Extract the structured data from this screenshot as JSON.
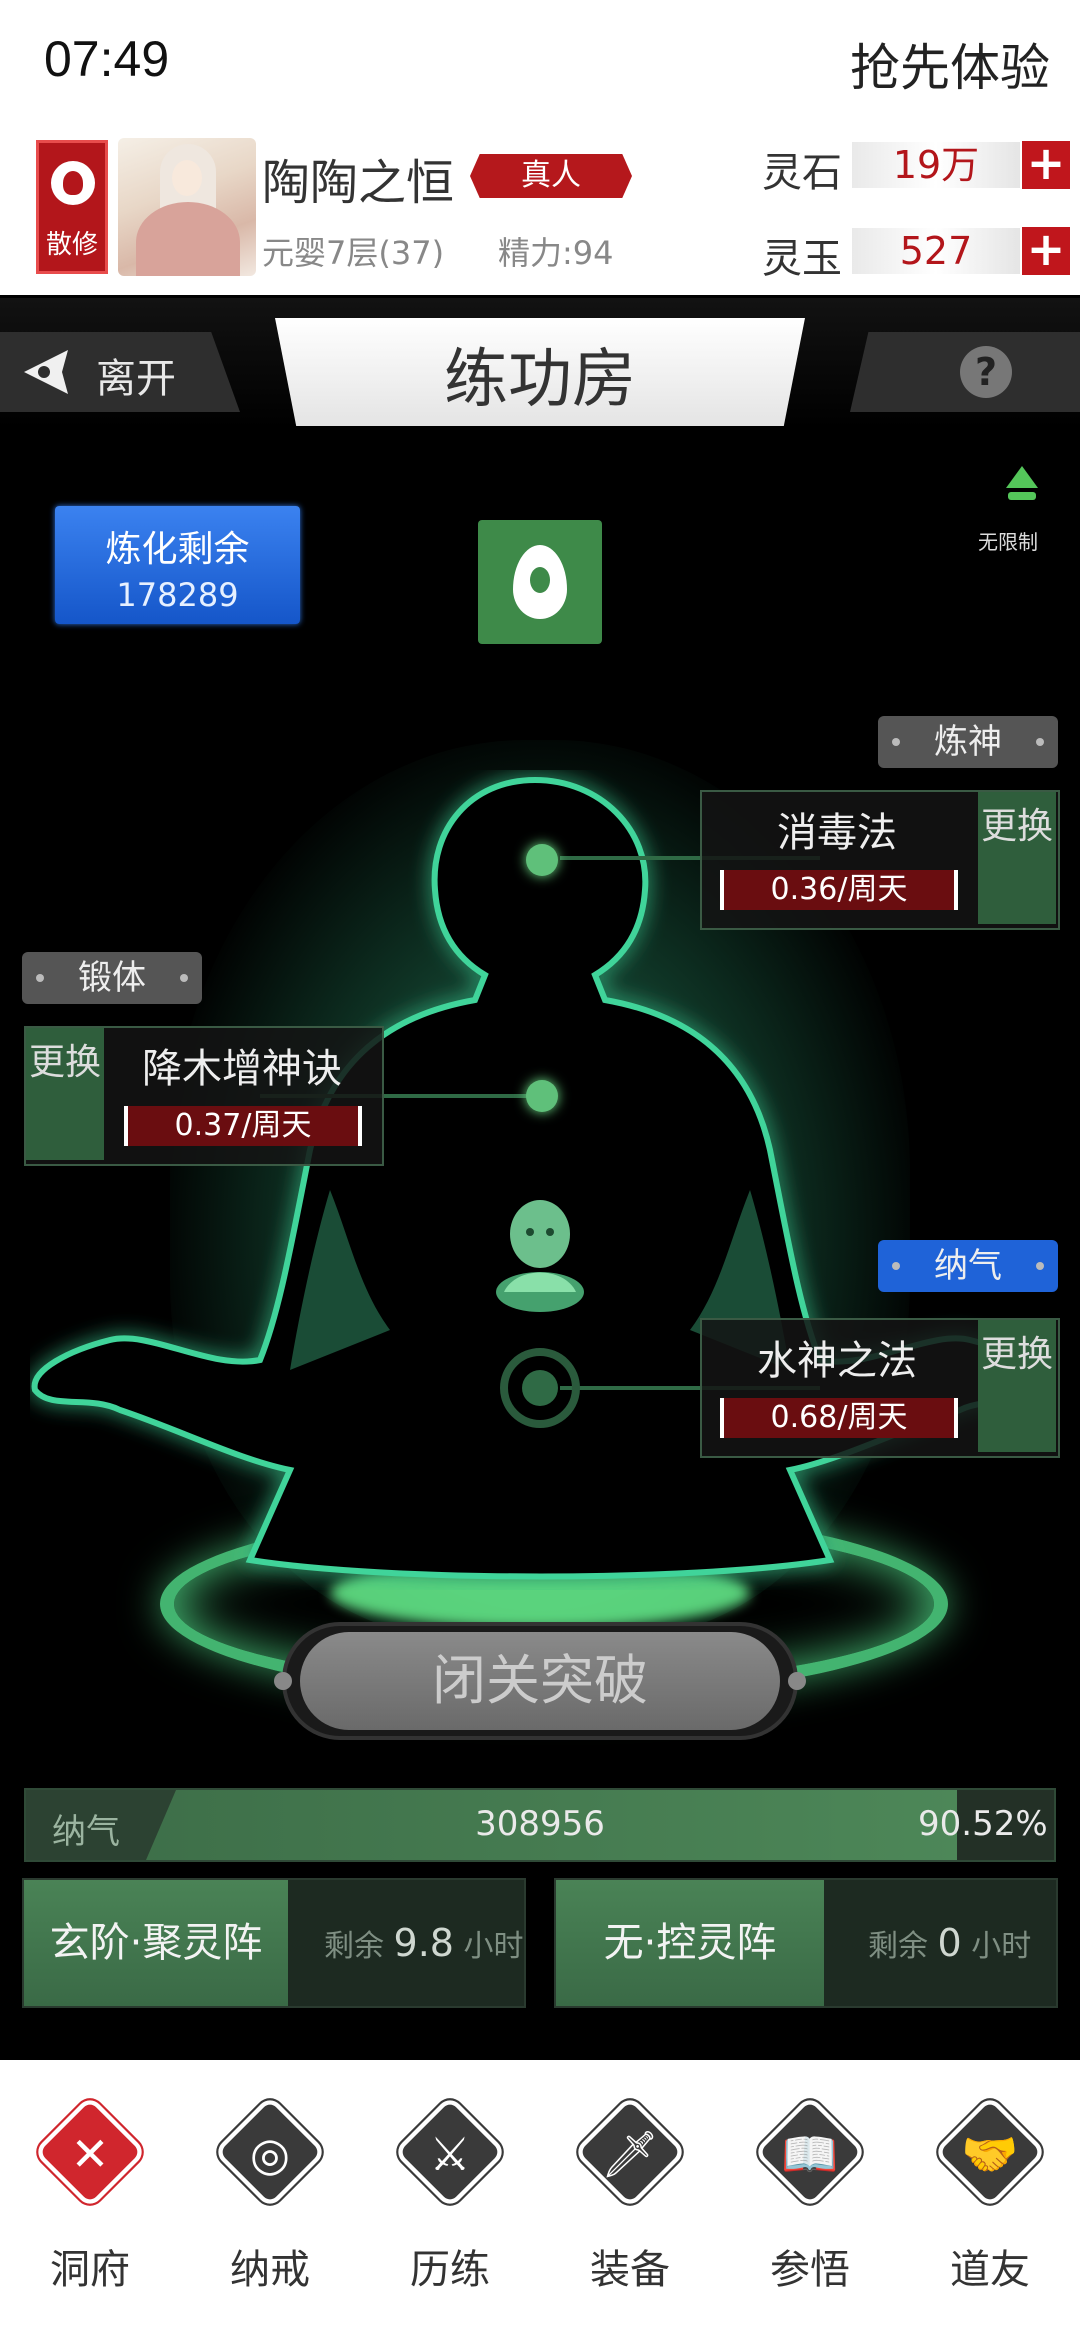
{
  "status": {
    "time": "07:49",
    "action": "抢先体验"
  },
  "player": {
    "sect": "散修",
    "name": "陶陶之恒",
    "rank": "真人",
    "realm": "元婴7层(37)",
    "stamina": "精力:94"
  },
  "currency": [
    {
      "label": "灵石",
      "value": "19万"
    },
    {
      "label": "灵玉",
      "value": "527"
    }
  ],
  "titlebar": {
    "back_label": "离开",
    "title": "练功房"
  },
  "refine": {
    "label": "炼化剩余",
    "value": "178289"
  },
  "unlimited_label": "无限制",
  "tags": {
    "refine_spirit": "炼神",
    "body": "锻体",
    "qi": "纳气"
  },
  "techniques": [
    {
      "name": "消毒法",
      "rate": "0.36/周天",
      "change": "更换"
    },
    {
      "name": "降木增神诀",
      "rate": "0.37/周天",
      "change": "更换"
    },
    {
      "name": "水神之法",
      "rate": "0.68/周天",
      "change": "更换"
    }
  ],
  "breakthrough_label": "闭关突破",
  "qi_bar": {
    "label": "纳气",
    "value": "308956",
    "percent_text": "90.52%",
    "fill_fraction": 0.9052
  },
  "arrays": [
    {
      "name": "玄阶·聚灵阵",
      "remain_prefix": "剩余",
      "remain_value": "9.8",
      "remain_unit": "小时"
    },
    {
      "name": "无·控灵阵",
      "remain_prefix": "剩余",
      "remain_value": "0",
      "remain_unit": "小时"
    }
  ],
  "nav": [
    {
      "label": "洞府",
      "icon": "close-icon",
      "active": true
    },
    {
      "label": "纳戒",
      "icon": "ring-icon",
      "active": false
    },
    {
      "label": "历练",
      "icon": "crossed-swords-icon",
      "active": false
    },
    {
      "label": "装备",
      "icon": "dagger-icon",
      "active": false
    },
    {
      "label": "参悟",
      "icon": "open-book-icon",
      "active": false
    },
    {
      "label": "道友",
      "icon": "handshake-icon",
      "active": false
    }
  ],
  "colors": {
    "accent_red": "#b3161b",
    "jade_green": "#3e8a49",
    "blue": "#1f63d8"
  }
}
